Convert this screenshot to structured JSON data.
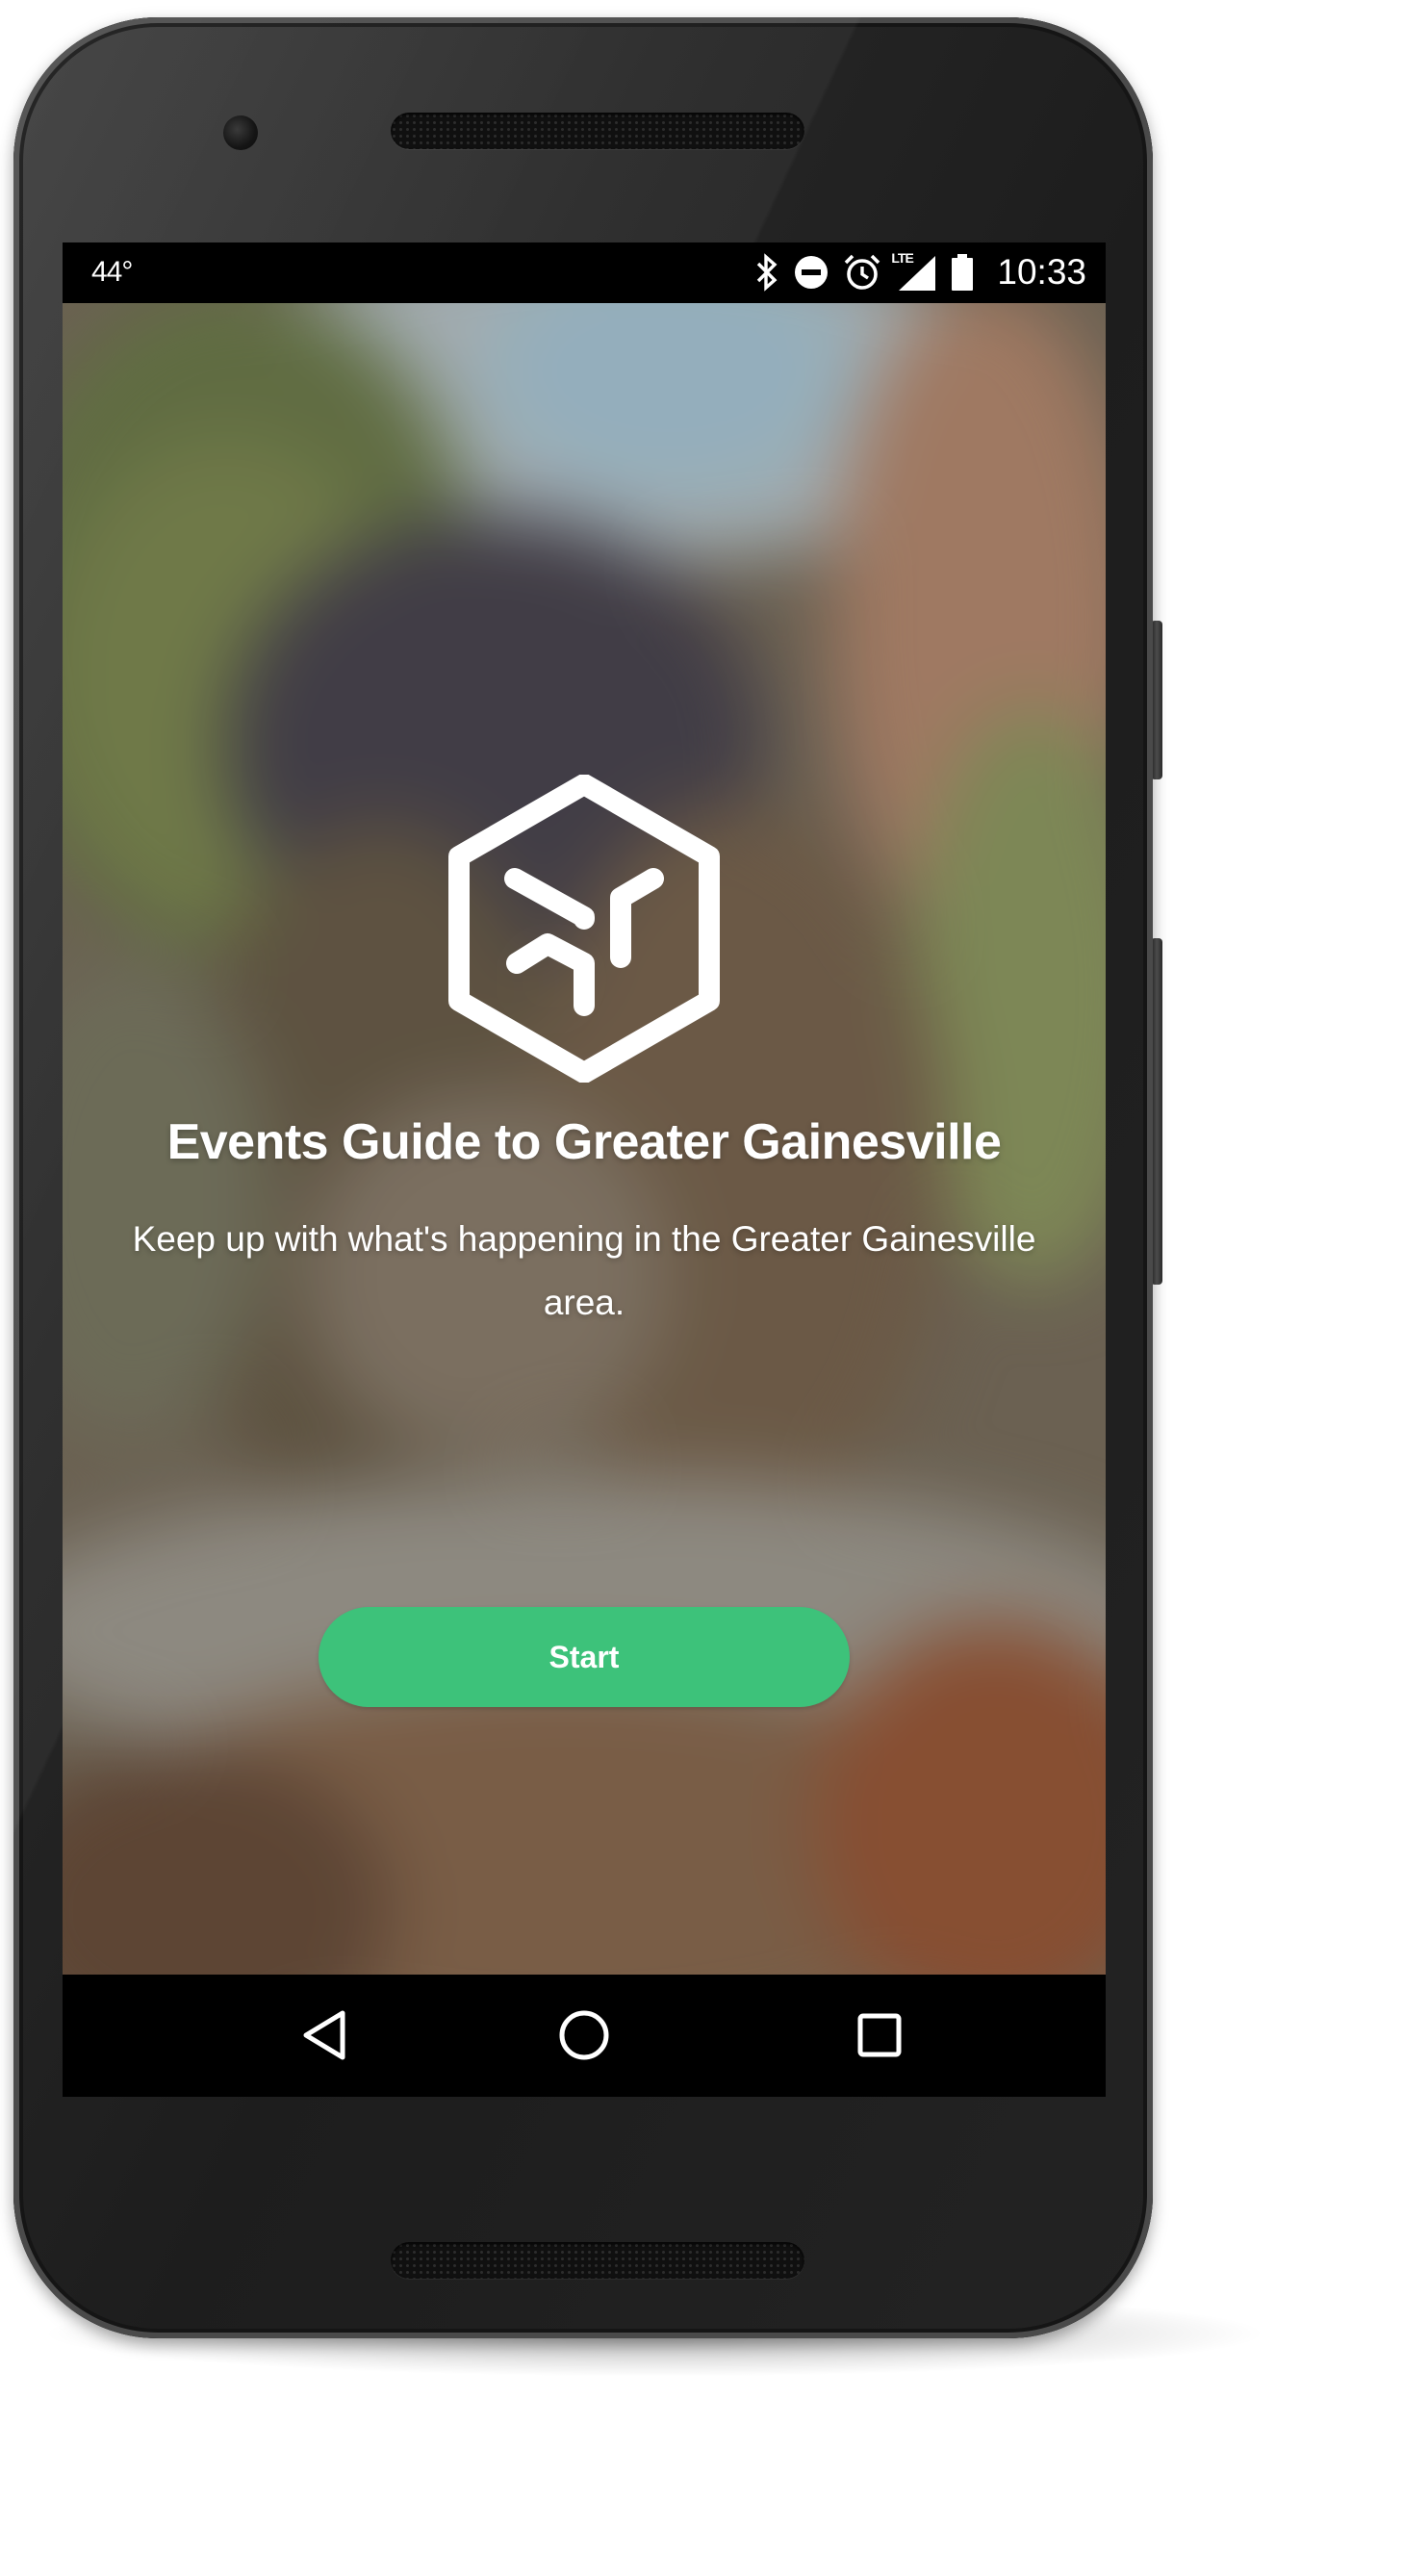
{
  "status_bar": {
    "temperature": "44°",
    "time": "10:33",
    "network_label": "LTE",
    "icons": [
      "bluetooth-icon",
      "do-not-disturb-icon",
      "alarm-icon",
      "lte-signal-icon",
      "battery-icon"
    ]
  },
  "welcome": {
    "logo_icon": "cube-logo-icon",
    "title": "Events Guide to Greater Gainesville",
    "subtitle": "Keep up with what's happening in the Greater Gainesville area.",
    "start_label": "Start"
  },
  "nav_bar": {
    "icons": [
      "back-icon",
      "home-icon",
      "recents-icon"
    ]
  },
  "colors": {
    "accent": "#3dc27a",
    "status_bar_bg": "#000000",
    "text": "#ffffff"
  }
}
